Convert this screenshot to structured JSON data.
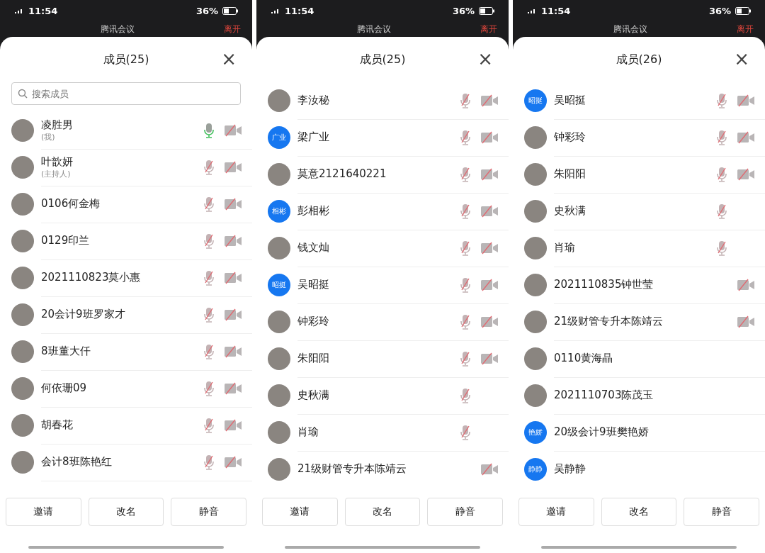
{
  "screens": [
    {
      "status_bar": {
        "time": "11:54",
        "battery": "36%"
      },
      "app_bar": {
        "title": "腾讯会议",
        "leave": "离开"
      },
      "sheet": {
        "title": "成员(25)",
        "close": "×",
        "search": {
          "placeholder": "搜索成员"
        },
        "members": [
          {
            "name": "凌胜男",
            "note": "(我)",
            "avatar": {
              "kind": "photo"
            },
            "mic": {
              "muted": false
            },
            "camera": {
              "off": true
            }
          },
          {
            "name": "叶歆妍",
            "note": "(主持人)",
            "avatar": {
              "kind": "photo"
            },
            "mic": {
              "muted": true
            },
            "camera": {
              "off": true
            }
          },
          {
            "name": "0106何金梅",
            "avatar": {
              "kind": "photo"
            },
            "mic": {
              "muted": true
            },
            "camera": {
              "off": true
            }
          },
          {
            "name": "0129印兰",
            "avatar": {
              "kind": "photo"
            },
            "mic": {
              "muted": true
            },
            "camera": {
              "off": true
            }
          },
          {
            "name": "2021110823莫小惠",
            "avatar": {
              "kind": "photo"
            },
            "mic": {
              "muted": true
            },
            "camera": {
              "off": true
            }
          },
          {
            "name": "20会计9班罗家才",
            "avatar": {
              "kind": "photo"
            },
            "mic": {
              "muted": true
            },
            "camera": {
              "off": true
            }
          },
          {
            "name": "8班董大仟",
            "avatar": {
              "kind": "photo"
            },
            "mic": {
              "muted": true
            },
            "camera": {
              "off": true
            }
          },
          {
            "name": "何依珊09",
            "avatar": {
              "kind": "photo"
            },
            "mic": {
              "muted": true
            },
            "camera": {
              "off": true
            }
          },
          {
            "name": "胡春花",
            "avatar": {
              "kind": "photo"
            },
            "mic": {
              "muted": true
            },
            "camera": {
              "off": true
            }
          },
          {
            "name": "会计8班陈艳红",
            "avatar": {
              "kind": "photo"
            },
            "mic": {
              "muted": true
            },
            "camera": {
              "off": true
            }
          }
        ],
        "buttons": [
          "邀请",
          "改名",
          "静音"
        ]
      }
    },
    {
      "status_bar": {
        "time": "11:54",
        "battery": "36%"
      },
      "app_bar": {
        "title": "腾讯会议",
        "leave": "离开"
      },
      "sheet": {
        "title": "成员(25)",
        "close": "×",
        "members": [
          {
            "name": "李汝秘",
            "avatar": {
              "kind": "photo"
            },
            "mic": {
              "muted": true
            },
            "camera": {
              "off": true
            }
          },
          {
            "name": "梁广业",
            "avatar": {
              "kind": "initials",
              "text": "广业"
            },
            "mic": {
              "muted": true
            },
            "camera": {
              "off": true
            }
          },
          {
            "name": "莫意2121640221",
            "avatar": {
              "kind": "photo"
            },
            "mic": {
              "muted": true
            },
            "camera": {
              "off": true
            }
          },
          {
            "name": "彭相彬",
            "avatar": {
              "kind": "initials",
              "text": "相彬"
            },
            "mic": {
              "muted": true
            },
            "camera": {
              "off": true
            }
          },
          {
            "name": "钱文灿",
            "avatar": {
              "kind": "photo"
            },
            "mic": {
              "muted": true
            },
            "camera": {
              "off": true
            }
          },
          {
            "name": "吴昭挺",
            "avatar": {
              "kind": "initials",
              "text": "昭挺"
            },
            "mic": {
              "muted": true
            },
            "camera": {
              "off": true
            }
          },
          {
            "name": "钟彩玲",
            "avatar": {
              "kind": "photo"
            },
            "mic": {
              "muted": true
            },
            "camera": {
              "off": true
            }
          },
          {
            "name": "朱阳阳",
            "avatar": {
              "kind": "photo"
            },
            "mic": {
              "muted": true
            },
            "camera": {
              "off": true
            }
          },
          {
            "name": "史秋满",
            "avatar": {
              "kind": "photo"
            },
            "mic": {
              "muted": true
            }
          },
          {
            "name": "肖瑜",
            "avatar": {
              "kind": "photo"
            },
            "mic": {
              "muted": true
            }
          },
          {
            "name": "21级财管专升本陈靖云",
            "avatar": {
              "kind": "photo"
            },
            "camera": {
              "off": true
            }
          }
        ],
        "buttons": [
          "邀请",
          "改名",
          "静音"
        ]
      }
    },
    {
      "status_bar": {
        "time": "11:54",
        "battery": "36%"
      },
      "app_bar": {
        "title": "腾讯会议",
        "leave": "离开"
      },
      "sheet": {
        "title": "成员(26)",
        "close": "×",
        "members": [
          {
            "name": "吴昭挺",
            "avatar": {
              "kind": "initials",
              "text": "昭挺"
            },
            "mic": {
              "muted": true
            },
            "camera": {
              "off": true
            }
          },
          {
            "name": "钟彩玲",
            "avatar": {
              "kind": "photo"
            },
            "mic": {
              "muted": true
            },
            "camera": {
              "off": true
            }
          },
          {
            "name": "朱阳阳",
            "avatar": {
              "kind": "photo"
            },
            "mic": {
              "muted": true
            },
            "camera": {
              "off": true
            }
          },
          {
            "name": "史秋满",
            "avatar": {
              "kind": "photo"
            },
            "mic": {
              "muted": true
            }
          },
          {
            "name": "肖瑜",
            "avatar": {
              "kind": "photo"
            },
            "mic": {
              "muted": true
            }
          },
          {
            "name": "2021110835钟世莹",
            "avatar": {
              "kind": "photo"
            },
            "camera": {
              "off": true
            }
          },
          {
            "name": "21级财管专升本陈靖云",
            "avatar": {
              "kind": "photo"
            },
            "camera": {
              "off": true
            }
          },
          {
            "name": "0110黄海晶",
            "avatar": {
              "kind": "photo"
            }
          },
          {
            "name": "2021110703陈茂玉",
            "avatar": {
              "kind": "photo"
            }
          },
          {
            "name": "20级会计9班樊艳娇",
            "avatar": {
              "kind": "initials",
              "text": "艳娇"
            }
          },
          {
            "name": "吴静静",
            "avatar": {
              "kind": "initials",
              "text": "静静"
            }
          }
        ],
        "buttons": [
          "邀请",
          "改名",
          "静音"
        ]
      }
    }
  ]
}
